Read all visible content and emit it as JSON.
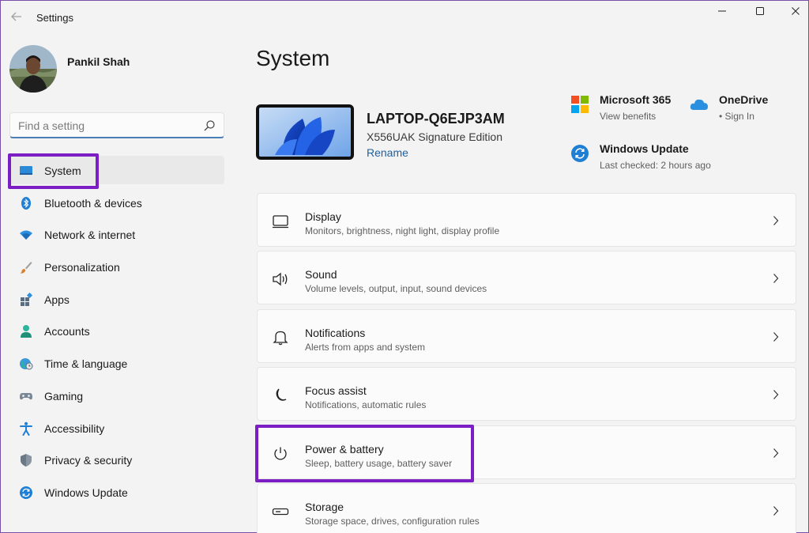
{
  "window": {
    "title": "Settings"
  },
  "profile": {
    "name": "Pankil Shah"
  },
  "search": {
    "placeholder": "Find a setting"
  },
  "sidebar": {
    "items": [
      {
        "label": "System",
        "icon": "display-icon"
      },
      {
        "label": "Bluetooth & devices",
        "icon": "bluetooth-icon"
      },
      {
        "label": "Network & internet",
        "icon": "wifi-icon"
      },
      {
        "label": "Personalization",
        "icon": "brush-icon"
      },
      {
        "label": "Apps",
        "icon": "apps-icon"
      },
      {
        "label": "Accounts",
        "icon": "person-icon"
      },
      {
        "label": "Time & language",
        "icon": "globe-clock-icon"
      },
      {
        "label": "Gaming",
        "icon": "gamepad-icon"
      },
      {
        "label": "Accessibility",
        "icon": "accessibility-icon"
      },
      {
        "label": "Privacy & security",
        "icon": "shield-icon"
      },
      {
        "label": "Windows Update",
        "icon": "update-icon"
      }
    ]
  },
  "main": {
    "title": "System",
    "device": {
      "name": "LAPTOP-Q6EJP3AM",
      "model": "X556UAK Signature Edition",
      "rename": "Rename"
    },
    "quick": {
      "microsoft365": {
        "title": "Microsoft 365",
        "sub": "View benefits"
      },
      "onedrive": {
        "title": "OneDrive",
        "sub": "• Sign In"
      },
      "update": {
        "title": "Windows Update",
        "sub": "Last checked: 2 hours ago"
      }
    },
    "cards": [
      {
        "title": "Display",
        "sub": "Monitors, brightness, night light, display profile",
        "icon": "monitor-icon"
      },
      {
        "title": "Sound",
        "sub": "Volume levels, output, input, sound devices",
        "icon": "speaker-icon"
      },
      {
        "title": "Notifications",
        "sub": "Alerts from apps and system",
        "icon": "bell-icon"
      },
      {
        "title": "Focus assist",
        "sub": "Notifications, automatic rules",
        "icon": "moon-icon"
      },
      {
        "title": "Power & battery",
        "sub": "Sleep, battery usage, battery saver",
        "icon": "power-icon"
      },
      {
        "title": "Storage",
        "sub": "Storage space, drives, configuration rules",
        "icon": "storage-icon"
      }
    ]
  },
  "colors": {
    "accent": "#0067c0",
    "highlight": "#7b1fc4",
    "link": "#1f5f9e"
  }
}
